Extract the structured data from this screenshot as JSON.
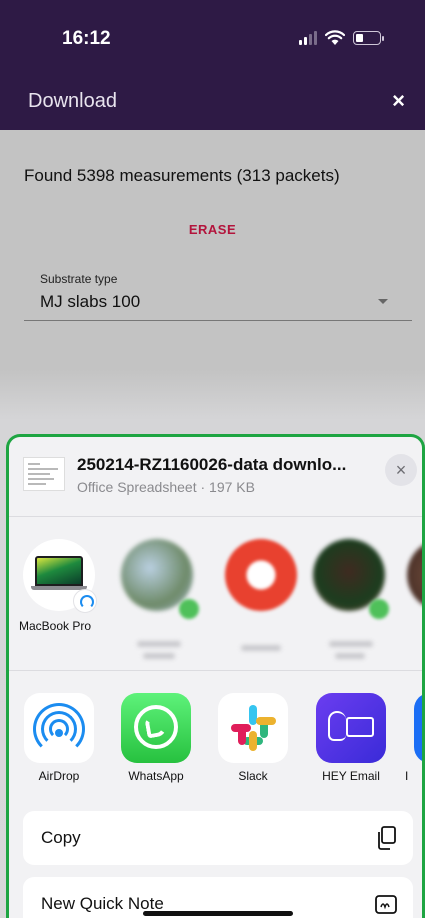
{
  "status": {
    "time": "16:12"
  },
  "app_bar": {
    "title": "Download",
    "close": "×"
  },
  "main": {
    "found_text": "Found 5398 measurements (313 packets)",
    "erase_label": "ERASE",
    "substrate": {
      "label": "Substrate type",
      "value": "MJ slabs 100"
    }
  },
  "share_sheet": {
    "file_name": "250214-RZ1160026-data downlo...",
    "file_meta": "Office Spreadsheet · 197 KB",
    "close": "×",
    "people": [
      {
        "label": "MacBook Pro"
      }
    ],
    "apps": [
      {
        "label": "AirDrop",
        "icon": "airdrop-icon"
      },
      {
        "label": "WhatsApp",
        "icon": "whatsapp-icon"
      },
      {
        "label": "Slack",
        "icon": "slack-icon"
      },
      {
        "label": "HEY Email",
        "icon": "hey-email-icon"
      },
      {
        "label": "I",
        "icon": "partial-app-icon"
      }
    ],
    "actions": [
      {
        "label": "Copy",
        "icon": "copy-icon"
      },
      {
        "label": "New Quick Note",
        "icon": "quick-note-icon"
      }
    ]
  },
  "colors": {
    "header_bg": "#2e1a45",
    "erase_red": "#b3143c",
    "sheet_border": "#1ea542",
    "airdrop_blue": "#1b8cf0",
    "whatsapp_green": "#27c13f",
    "hey_purple": "#5a36ea"
  }
}
